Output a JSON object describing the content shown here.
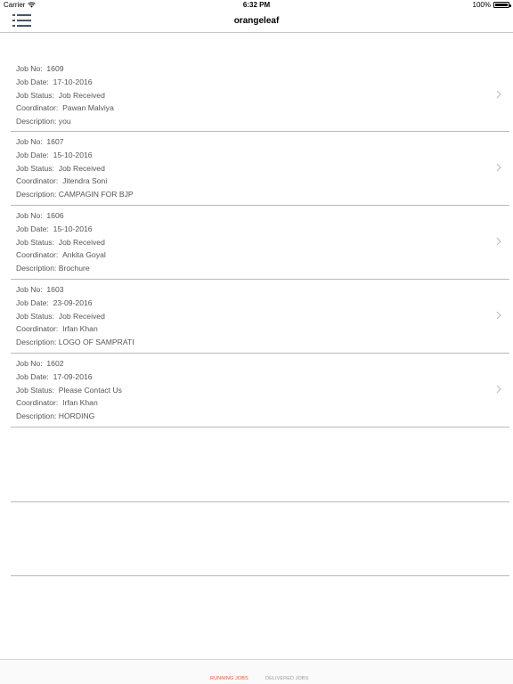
{
  "status_bar": {
    "carrier": "Carrier",
    "time": "6:32 PM",
    "battery": "100%",
    "battery_level": 1.0
  },
  "header": {
    "title": "orangeleaf",
    "menu_icon": "list-menu-icon"
  },
  "labels": {
    "job_no": "Job No:",
    "job_date": "Job Date:",
    "job_status": "Job Status:",
    "coordinator": "Coordinator:",
    "description": "Description:"
  },
  "jobs": [
    {
      "job_no": "1609",
      "job_date": "17-10-2016",
      "status": "Job Received",
      "coordinator": "Pawan Malviya",
      "description": "you"
    },
    {
      "job_no": "1607",
      "job_date": "15-10-2016",
      "status": "Job Received",
      "coordinator": "Jitendra Soni",
      "description": "CAMPAGIN FOR BJP"
    },
    {
      "job_no": "1606",
      "job_date": "15-10-2016",
      "status": "Job Received",
      "coordinator": "Ankita Goyal",
      "description": "Brochure"
    },
    {
      "job_no": "1603",
      "job_date": "23-09-2016",
      "status": "Job Received",
      "coordinator": "Irfan Khan",
      "description": "LOGO OF SAMPRATI"
    },
    {
      "job_no": "1602",
      "job_date": "17-09-2016",
      "status": "Please Contact Us",
      "coordinator": "Irfan Khan",
      "description": "HORDING"
    }
  ],
  "tabs": {
    "running": "RUNNING JOBS",
    "delivered": "DELIVERED JOBS",
    "active_color": "#e8552b",
    "inactive_color": "#9a9a9a"
  }
}
